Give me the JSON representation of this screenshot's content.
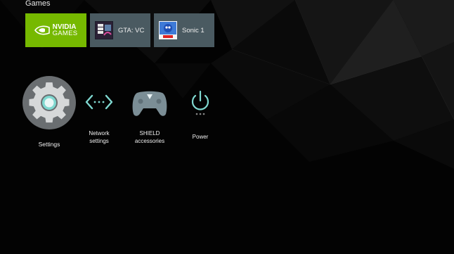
{
  "games": {
    "title": "Games",
    "items": [
      {
        "label_line1": "NVIDIA",
        "label_line2": "GAMES",
        "icon": "nvidia-eye-logo",
        "accent": "#76b900"
      },
      {
        "label": "GTA: VC",
        "icon": "gta-vice-city-cover"
      },
      {
        "label": "Sonic 1",
        "icon": "sonic-cover"
      }
    ]
  },
  "settings": {
    "items": [
      {
        "label": "Settings",
        "icon": "gear-icon",
        "selected": true
      },
      {
        "label": "Network\nsettings",
        "icon": "network-arrows-icon"
      },
      {
        "label": "SHIELD\naccessories",
        "icon": "shield-controller-icon"
      },
      {
        "label": "Power",
        "icon": "power-icon"
      }
    ],
    "accent": "#7fd8d0"
  }
}
